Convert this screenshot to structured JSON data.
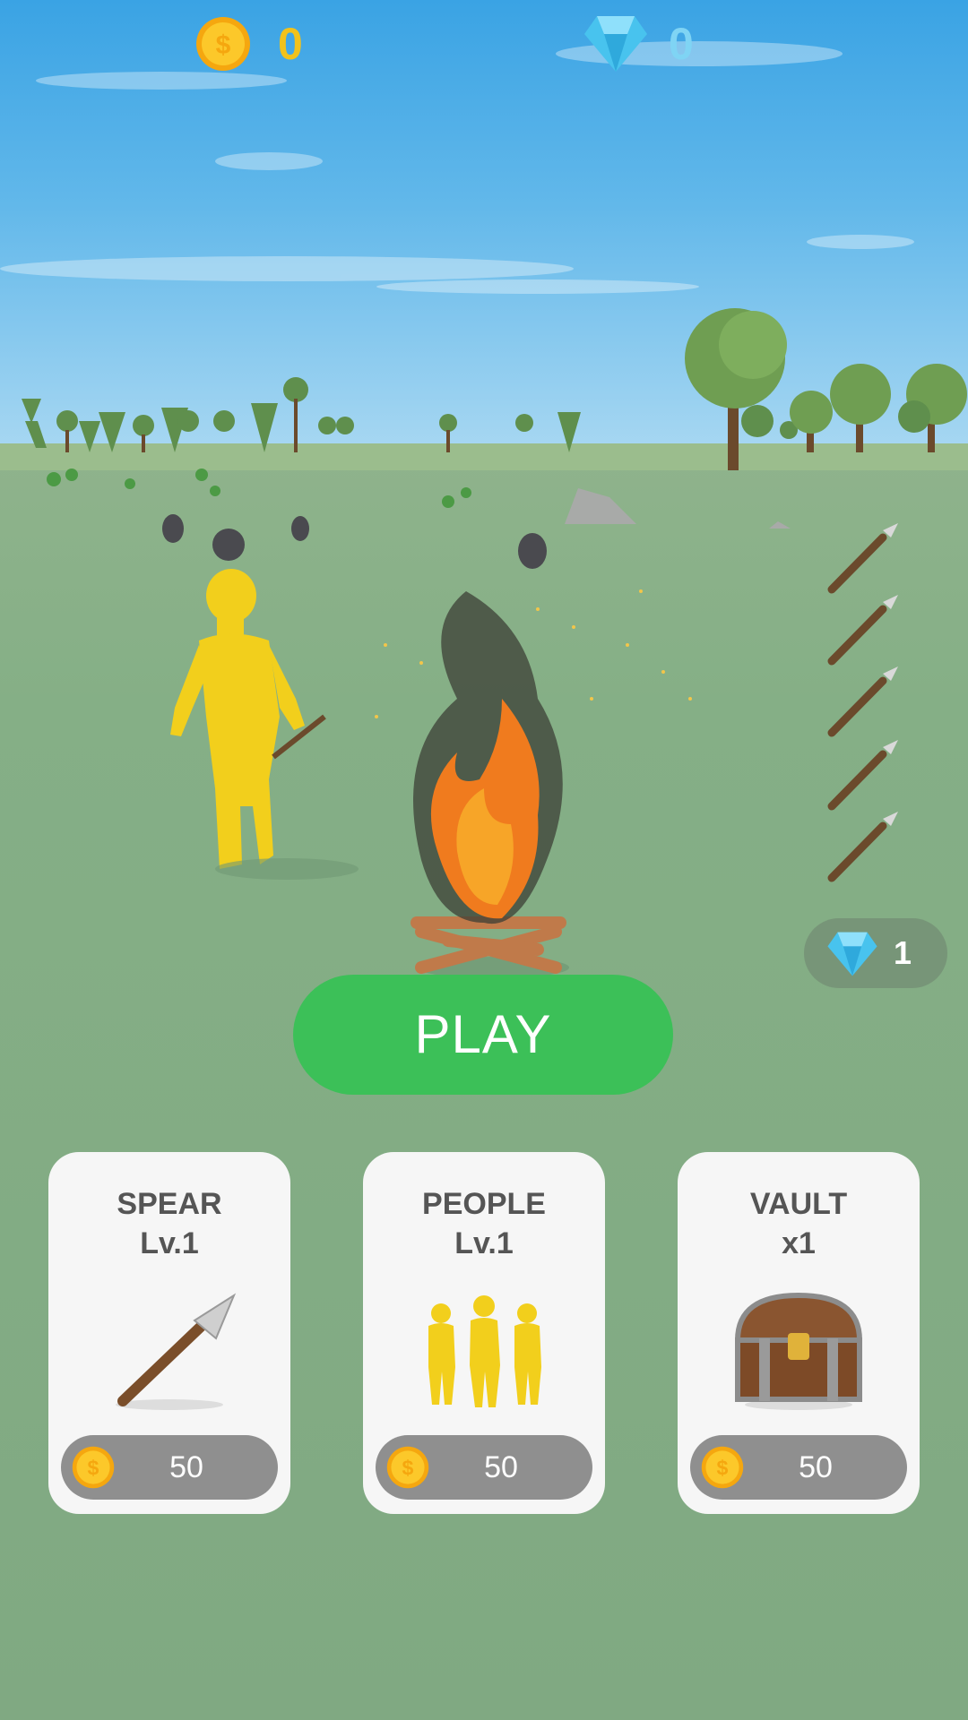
{
  "hud": {
    "coins": "0",
    "gems": "0"
  },
  "gem_pickup": {
    "value": "1"
  },
  "play_button": {
    "label": "PLAY"
  },
  "upgrades": [
    {
      "title": "SPEAR",
      "subtitle": "Lv.1",
      "price": "50",
      "icon": "spear-icon"
    },
    {
      "title": "PEOPLE",
      "subtitle": "Lv.1",
      "price": "50",
      "icon": "people-icon"
    },
    {
      "title": "VAULT",
      "subtitle": "x1",
      "price": "50",
      "icon": "chest-icon"
    }
  ],
  "colors": {
    "coin": "#f2c21b",
    "gem": "#7fd4f4",
    "play": "#3cc058",
    "card": "#f6f6f6",
    "price_pill": "#8f8f8f"
  }
}
